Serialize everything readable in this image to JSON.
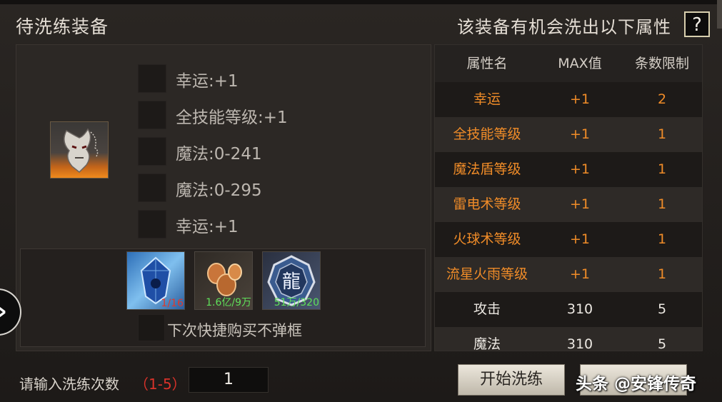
{
  "header": {
    "left_title": "待洗练装备",
    "right_title": "该装备有机会洗出以下属性",
    "help_label": "?"
  },
  "equipment": {
    "icon": "demon-mask-helmet-icon",
    "attributes": [
      {
        "text": "幸运:+1"
      },
      {
        "text": "全技能等级:+1"
      },
      {
        "text": "魔法:0-241"
      },
      {
        "text": "魔法:0-295"
      },
      {
        "text": "幸运:+1"
      }
    ]
  },
  "materials": [
    {
      "icon": "blue-crystal-icon",
      "count": "1/16",
      "count_color": "#e0392b"
    },
    {
      "icon": "gold-coins-icon",
      "count": "1.6亿/9万",
      "count_color": "#5fe05a"
    },
    {
      "icon": "dragon-coin-icon",
      "count": "51万/320",
      "count_color": "#5fe05a"
    }
  ],
  "no_popup_label": "下次快捷购买不弹框",
  "attribute_table": {
    "headers": [
      "属性名",
      "MAX值",
      "条数限制"
    ],
    "rows": [
      {
        "name": "幸运",
        "max": "+1",
        "limit": "2",
        "highlight": true
      },
      {
        "name": "全技能等级",
        "max": "+1",
        "limit": "1",
        "highlight": true
      },
      {
        "name": "魔法盾等级",
        "max": "+1",
        "limit": "1",
        "highlight": true
      },
      {
        "name": "雷电术等级",
        "max": "+1",
        "limit": "1",
        "highlight": true
      },
      {
        "name": "火球术等级",
        "max": "+1",
        "limit": "1",
        "highlight": true
      },
      {
        "name": "流星火雨等级",
        "max": "+1",
        "limit": "1",
        "highlight": true
      },
      {
        "name": "攻击",
        "max": "310",
        "limit": "5",
        "highlight": false
      },
      {
        "name": "魔法",
        "max": "310",
        "limit": "5",
        "highlight": false
      }
    ]
  },
  "footer": {
    "count_label": "请输入洗练次数",
    "count_range": "（1-5）",
    "count_value": "1",
    "start_button": "开始洗练"
  },
  "watermark": "头条 @安锋传奇",
  "colors": {
    "highlight_orange": "#f08c28",
    "normal_white": "#ece8e2",
    "header_text": "#d4cec6"
  }
}
